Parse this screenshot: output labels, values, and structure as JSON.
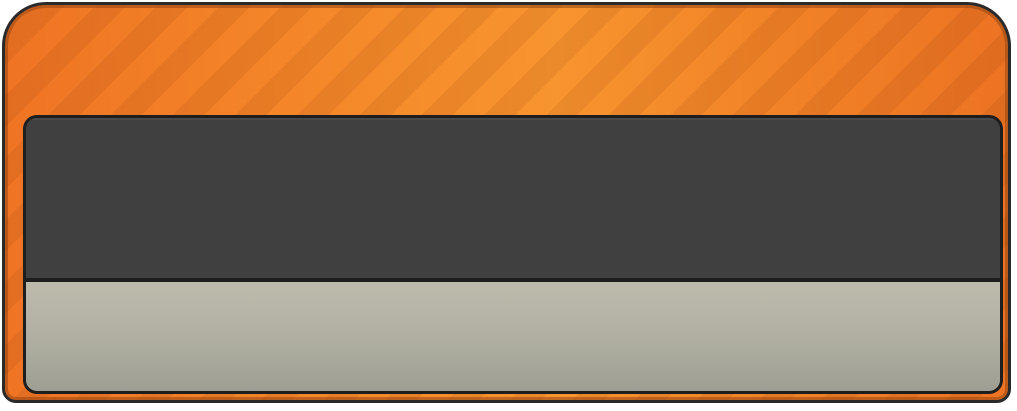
{
  "panel": {
    "title": "",
    "accent_color": "#f58a2a",
    "border_color": "#2a2a2a"
  },
  "display": {
    "top_text": "",
    "bottom_text": "",
    "top_color": "#404040",
    "bottom_color": "#b4b3a6"
  }
}
